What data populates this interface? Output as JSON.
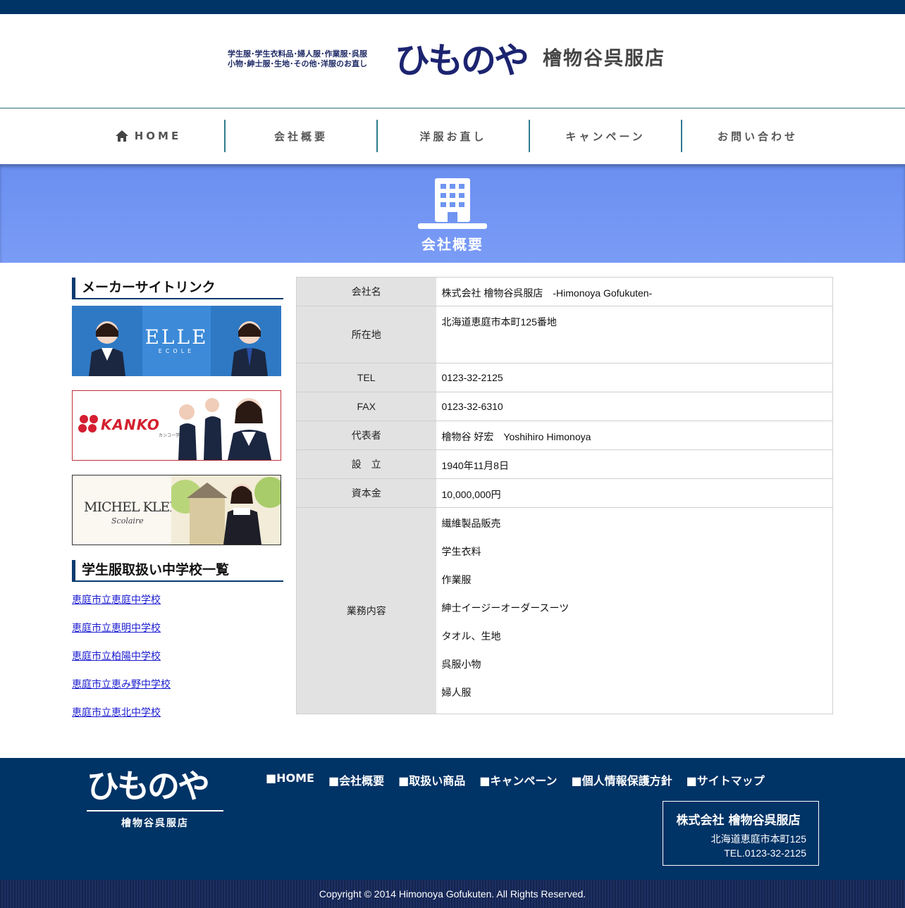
{
  "header": {
    "tagline_1": "学生服･学生衣料品･婦人服･作業服･呉服",
    "tagline_2": "小物･紳士服･生地･その他･洋服のお直し",
    "logo_mark": "ひものや",
    "logo_name": "檜物谷呉服店"
  },
  "nav": {
    "items": [
      "HOME",
      "会社概要",
      "洋服お直し",
      "キャンペーン",
      "お問い合わせ"
    ]
  },
  "banner": {
    "title": "会社概要",
    "icon": "building-icon"
  },
  "sidebar": {
    "maker_heading": "メーカーサイトリンク",
    "makers": {
      "elle": {
        "logo": "ELLE",
        "sub": "ECOLE"
      },
      "kanko": {
        "logo": "KANKO",
        "sub": "カンコー学生服"
      },
      "michel": {
        "logo": "MICHEL KLEIN",
        "sub": "Scolaire"
      }
    },
    "school_heading": "学生服取扱い中学校一覧",
    "schools": [
      "恵庭市立恵庭中学校",
      "恵庭市立恵明中学校",
      "恵庭市立柏陽中学校",
      "恵庭市立恵み野中学校",
      "恵庭市立恵北中学校"
    ]
  },
  "company": {
    "rows": [
      {
        "label": "会社名",
        "value": "株式会社 檜物谷呉服店　-Himonoya Gofukuten-"
      },
      {
        "label": "所在地",
        "value": "北海道恵庭市本町125番地"
      },
      {
        "label": "TEL",
        "value": "0123-32-2125"
      },
      {
        "label": "FAX",
        "value": "0123-32-6310"
      },
      {
        "label": "代表者",
        "value": "檜物谷 好宏　Yoshihiro Himonoya"
      },
      {
        "label": "設　立",
        "value": "1940年11月8日"
      },
      {
        "label": "資本金",
        "value": "10,000,000円"
      }
    ],
    "business_label": "業務内容",
    "business": [
      "繊維製品販売",
      "学生衣料",
      "作業服",
      "紳士イージーオーダースーツ",
      "タオル、生地",
      "呉服小物",
      "婦人服"
    ]
  },
  "footer": {
    "logo_mark": "ひものや",
    "logo_sub": "檜物谷呉服店",
    "links": [
      "■HOME",
      "■会社概要",
      "■取扱い商品",
      "■キャンペーン",
      "■個人情報保護方針",
      "■サイトマップ"
    ],
    "company": "株式会社 檜物谷呉服店",
    "address": "北海道恵庭市本町125",
    "tel": "TEL.0123-32-2125",
    "copyright": "Copyright © 2014 Himonoya Gofukuten. All Rights Reserved."
  },
  "colors": {
    "navy": "#003366",
    "banner": "#7096f2",
    "nav_divider": "#2e7c8c",
    "link": "#1a1ad0"
  }
}
